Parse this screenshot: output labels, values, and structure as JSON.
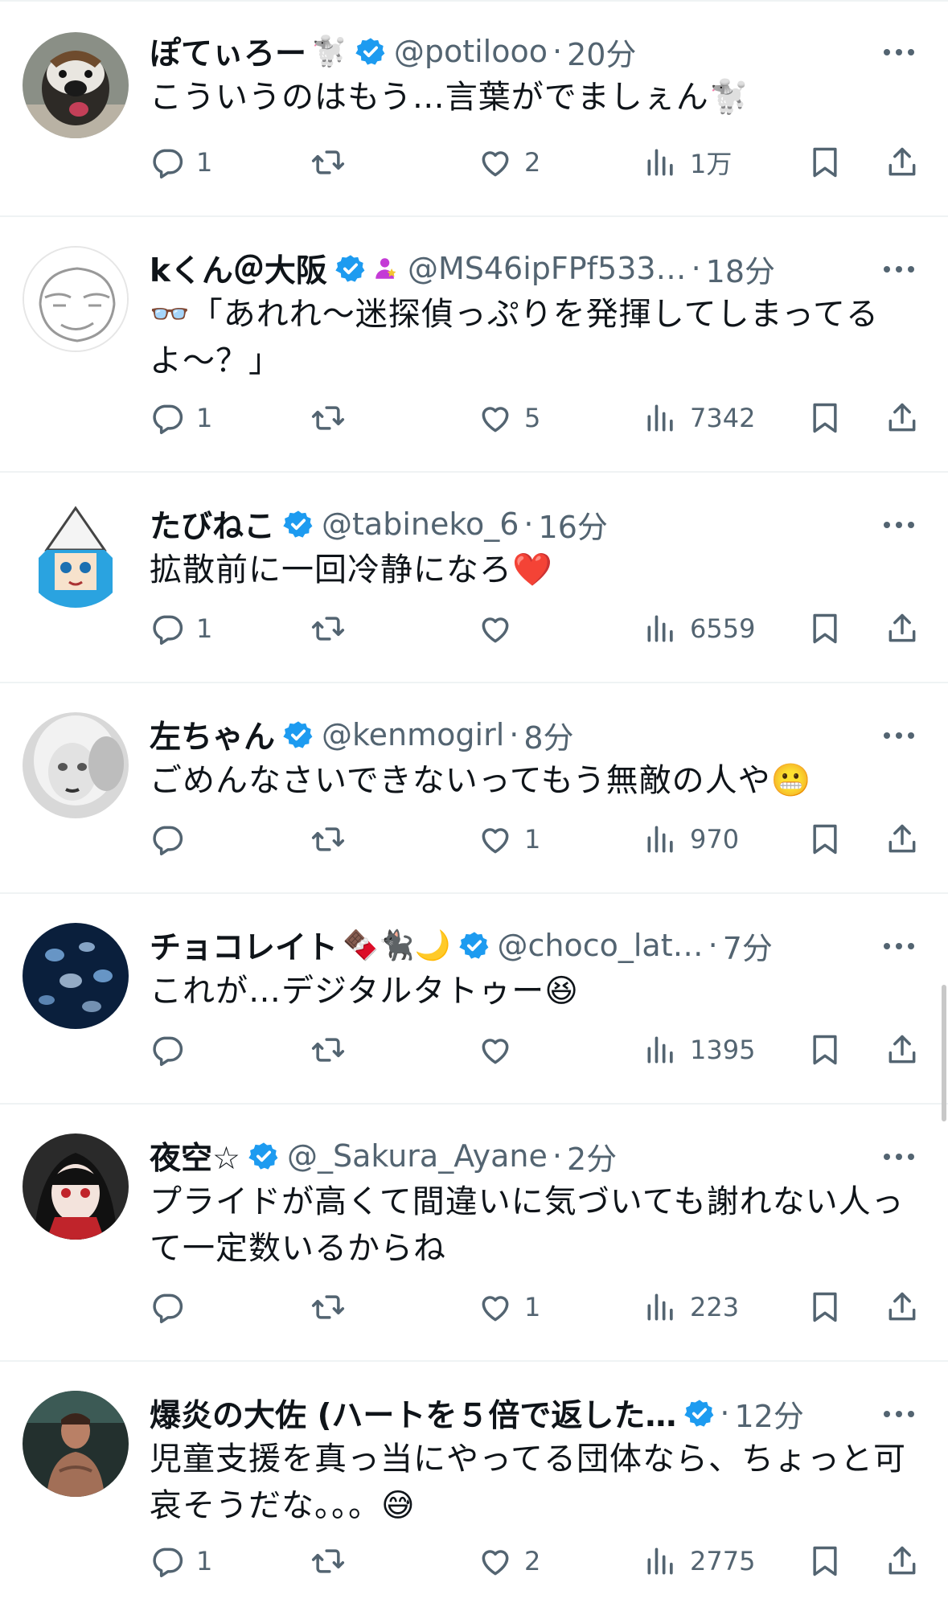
{
  "replies": [
    {
      "name": "ぽてぃろー",
      "name_emoji": "🐩",
      "handle": "@potilooo",
      "time": "20分",
      "text": "こういうのはもう…言葉がでましぇん🐩",
      "counts": {
        "reply": "1",
        "retweet": "",
        "like": "2",
        "views": "1万"
      }
    },
    {
      "name": "kくん＠大阪",
      "name_emoji": "",
      "handle": "@MS46ipFPf533…",
      "time": "18分",
      "text": "👓「あれれ〜迷探偵っぷりを発揮してしまってるよ〜？」",
      "counts": {
        "reply": "1",
        "retweet": "",
        "like": "5",
        "views": "7342"
      }
    },
    {
      "name": "たびねこ",
      "name_emoji": "",
      "handle": "@tabineko_6",
      "time": "16分",
      "text": "拡散前に一回冷静になろ❤️",
      "counts": {
        "reply": "1",
        "retweet": "",
        "like": "",
        "views": "6559"
      }
    },
    {
      "name": "左ちゃん",
      "name_emoji": "",
      "handle": "@kenmogirl",
      "time": "8分",
      "text": "ごめんなさいできないってもう無敵の人や😬",
      "counts": {
        "reply": "",
        "retweet": "",
        "like": "1",
        "views": "970"
      }
    },
    {
      "name": "チョコレイト",
      "name_emoji": "🍫🐈‍⬛🌙",
      "handle": "@choco_lat…",
      "time": "7分",
      "text": "これが…デジタルタトゥー😆",
      "counts": {
        "reply": "",
        "retweet": "",
        "like": "",
        "views": "1395"
      }
    },
    {
      "name": "夜空☆",
      "name_emoji": "",
      "handle": "@_Sakura_Ayane",
      "time": "2分",
      "text": "プライドが高くて間違いに気づいても謝れない人って一定数いるからね",
      "counts": {
        "reply": "",
        "retweet": "",
        "like": "1",
        "views": "223"
      }
    },
    {
      "name": "爆炎の大佐 (ハートを５倍で返した…",
      "name_emoji": "",
      "handle": "",
      "time": "12分",
      "text": "児童支援を真っ当にやってる団体なら、ちょっと可哀そうだな。。。😅",
      "counts": {
        "reply": "1",
        "retweet": "",
        "like": "2",
        "views": "2775"
      }
    }
  ],
  "colors": {
    "verified": "#1d9bf0",
    "secondary_text": "#536471",
    "separator": "#eff3f4",
    "badge_purple": "#c43bd6"
  },
  "icons": [
    "reply-icon",
    "retweet-icon",
    "like-icon",
    "views-icon",
    "bookmark-icon",
    "share-icon",
    "more-icon",
    "verified-badge-icon"
  ]
}
